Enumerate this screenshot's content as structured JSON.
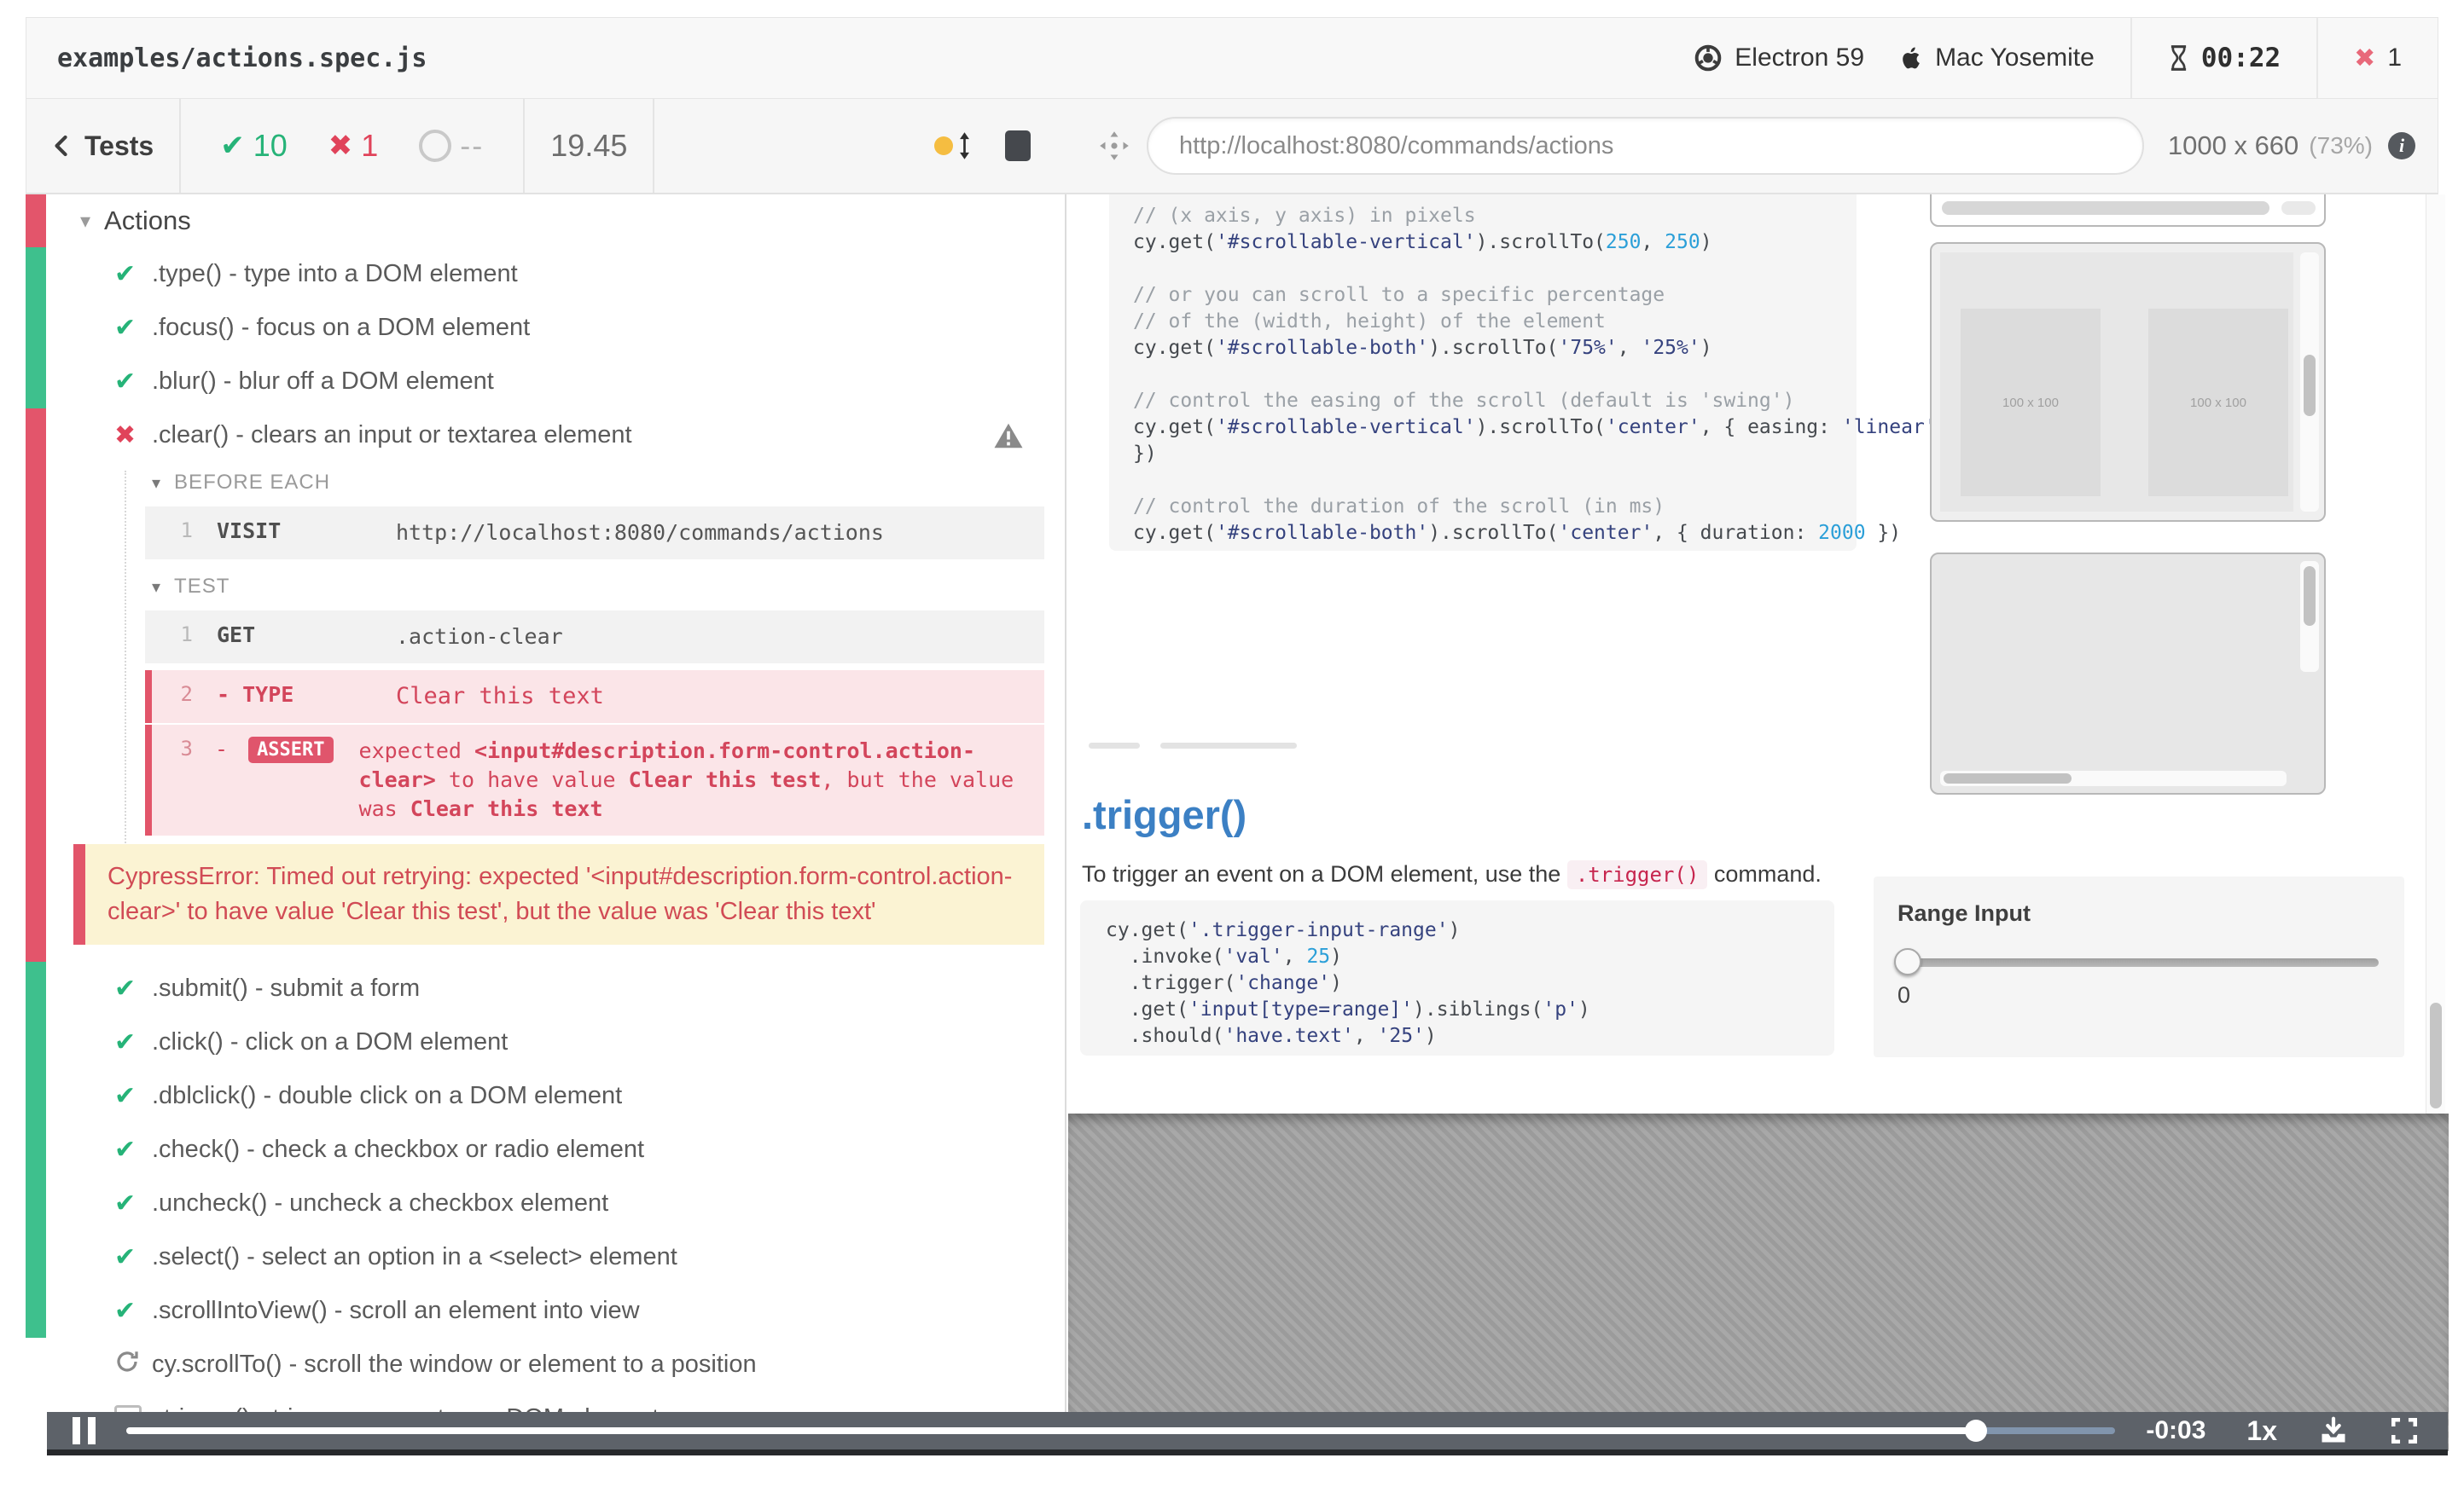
{
  "header": {
    "spec": "examples/actions.spec.js",
    "browser": "Electron 59",
    "os": "Mac Yosemite",
    "timer": "00:22",
    "failure_count": "1"
  },
  "toolbar": {
    "back_label": "Tests",
    "passed": "10",
    "failed": "1",
    "pending": "--",
    "duration": "19.45",
    "url": "http://localhost:8080/commands/actions",
    "viewport": "1000 x 660",
    "zoom": "(73%)"
  },
  "suite": {
    "title": "Actions"
  },
  "tests_top": [
    {
      "state": "passed",
      "title": ".type() - type into a DOM element"
    },
    {
      "state": "passed",
      "title": ".focus() - focus on a DOM element"
    },
    {
      "state": "passed",
      "title": ".blur() - blur off a DOM element"
    }
  ],
  "failed_test": {
    "title": ".clear() - clears an input or textarea element",
    "before_each_label": "BEFORE EACH",
    "test_label": "TEST",
    "visit": {
      "n": "1",
      "cmd": "VISIT",
      "msg": "http://localhost:8080/commands/actions"
    },
    "get": {
      "n": "1",
      "cmd": "GET",
      "msg": ".action-clear"
    },
    "type": {
      "n": "2",
      "cmd": "TYPE",
      "msg": "Clear this text"
    },
    "assert": {
      "n": "3",
      "cmd": "ASSERT",
      "msg": [
        {
          "t": "expected "
        },
        {
          "s": "b",
          "t": "<input#description.form-control.action-clear>"
        },
        {
          "t": " to have value "
        },
        {
          "s": "b",
          "t": "Clear this test"
        },
        {
          "t": ", but the value was "
        },
        {
          "s": "b",
          "t": "Clear this text"
        }
      ]
    },
    "error": "CypressError: Timed out retrying: expected '<input#description.form-control.action-clear>' to have value 'Clear this test', but the value was 'Clear this text'"
  },
  "tests_bottom": [
    {
      "state": "passed",
      "title": ".submit() - submit a form"
    },
    {
      "state": "passed",
      "title": ".click() - click on a DOM element"
    },
    {
      "state": "passed",
      "title": ".dblclick() - double click on a DOM element"
    },
    {
      "state": "passed",
      "title": ".check() - check a checkbox or radio element"
    },
    {
      "state": "passed",
      "title": ".uncheck() - uncheck a checkbox element"
    },
    {
      "state": "passed",
      "title": ".select() - select an option in a <select> element"
    },
    {
      "state": "passed",
      "title": ".scrollIntoView() - scroll an element into view"
    },
    {
      "state": "running",
      "title": "cy.scrollTo() - scroll the window or element to a position"
    },
    {
      "state": "pending",
      "title": ".trigger() - trigger an event on a DOM element"
    }
  ],
  "aut": {
    "code1": {
      "lines": [
        [
          {
            "c": "c",
            "t": "// (x axis, y axis) in pixels"
          }
        ],
        [
          {
            "t": "cy.get("
          },
          {
            "c": "s",
            "t": "'#scrollable-vertical'"
          },
          {
            "t": ").scrollTo("
          },
          {
            "c": "n",
            "t": "250"
          },
          {
            "t": ", "
          },
          {
            "c": "n",
            "t": "250"
          },
          {
            "t": ")"
          }
        ],
        [],
        [
          {
            "c": "c",
            "t": "// or you can scroll to a specific percentage"
          }
        ],
        [
          {
            "c": "c",
            "t": "// of the (width, height) of the element"
          }
        ],
        [
          {
            "t": "cy.get("
          },
          {
            "c": "s",
            "t": "'#scrollable-both'"
          },
          {
            "t": ").scrollTo("
          },
          {
            "c": "s",
            "t": "'75%'"
          },
          {
            "t": ", "
          },
          {
            "c": "s",
            "t": "'25%'"
          },
          {
            "t": ")"
          }
        ],
        [],
        [
          {
            "c": "c",
            "t": "// control the easing of the scroll (default is 'swing')"
          }
        ],
        [
          {
            "t": "cy.get("
          },
          {
            "c": "s",
            "t": "'#scrollable-vertical'"
          },
          {
            "t": ").scrollTo("
          },
          {
            "c": "s",
            "t": "'center'"
          },
          {
            "t": ", { easing: "
          },
          {
            "c": "s",
            "t": "'linear'"
          }
        ],
        [
          {
            "t": "})"
          }
        ],
        [],
        [
          {
            "c": "c",
            "t": "// control the duration of the scroll (in ms)"
          }
        ],
        [
          {
            "t": "cy.get("
          },
          {
            "c": "s",
            "t": "'#scrollable-both'"
          },
          {
            "t": ").scrollTo("
          },
          {
            "c": "s",
            "t": "'center'"
          },
          {
            "t": ", { duration: "
          },
          {
            "c": "n",
            "t": "2000"
          },
          {
            "t": " })"
          }
        ]
      ]
    },
    "boxes": {
      "placeholder": "100 x 100"
    },
    "trigger": {
      "heading": ".trigger()",
      "para": [
        {
          "t": "To trigger an event on a DOM element, use the "
        },
        {
          "s": "code",
          "t": ".trigger()"
        },
        {
          "t": " command."
        }
      ],
      "code2": {
        "lines": [
          [
            {
              "t": "cy.get("
            },
            {
              "c": "s",
              "t": "'.trigger-input-range'"
            },
            {
              "t": ")"
            }
          ],
          [
            {
              "t": "  .invoke("
            },
            {
              "c": "s",
              "t": "'val'"
            },
            {
              "t": ", "
            },
            {
              "c": "n",
              "t": "25"
            },
            {
              "t": ")"
            }
          ],
          [
            {
              "t": "  .trigger("
            },
            {
              "c": "s",
              "t": "'change'"
            },
            {
              "t": ")"
            }
          ],
          [
            {
              "t": "  .get("
            },
            {
              "c": "s",
              "t": "'input[type=range]'"
            },
            {
              "t": ").siblings("
            },
            {
              "c": "s",
              "t": "'p'"
            },
            {
              "t": ")"
            }
          ],
          [
            {
              "t": "  .should("
            },
            {
              "c": "s",
              "t": "'have.text'"
            },
            {
              "t": ", "
            },
            {
              "c": "s",
              "t": "'25'"
            },
            {
              "t": ")"
            }
          ]
        ]
      }
    },
    "range": {
      "label": "Range Input",
      "value": "0"
    }
  },
  "player": {
    "time": "-0:03",
    "speed": "1x"
  },
  "colors": {
    "pass_green": "#26b378",
    "fail_red": "#e0435a",
    "strip_green": "#3ec08d",
    "strip_red": "#e3556b",
    "error_bg": "#fbf3d3",
    "link_blue": "#3c80c4",
    "autoscroll_yellow": "#f5bd41"
  }
}
